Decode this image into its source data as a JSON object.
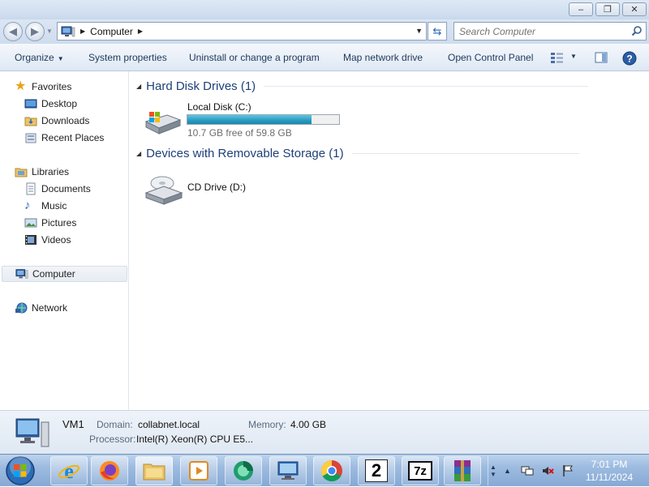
{
  "window": {
    "minimize": "‒",
    "maximize": "❐",
    "close": "✕"
  },
  "address": {
    "crumb": "Computer",
    "search_placeholder": "Search Computer"
  },
  "toolbar": {
    "organize": "Organize",
    "system_properties": "System properties",
    "uninstall": "Uninstall or change a program",
    "map_drive": "Map network drive",
    "control_panel": "Open Control Panel"
  },
  "nav": {
    "favorites": "Favorites",
    "desktop": "Desktop",
    "downloads": "Downloads",
    "recent": "Recent Places",
    "libraries": "Libraries",
    "documents": "Documents",
    "music": "Music",
    "pictures": "Pictures",
    "videos": "Videos",
    "computer": "Computer",
    "network": "Network"
  },
  "groups": {
    "hdd": "Hard Disk Drives (1)",
    "removable": "Devices with Removable Storage (1)"
  },
  "drives": {
    "c_label": "Local Disk (C:)",
    "c_free": "10.7 GB free of 59.8 GB",
    "c_used_fraction": 0.82,
    "d_label": "CD Drive (D:)"
  },
  "details": {
    "name": "VM1",
    "domain_key": "Domain:",
    "domain_val": "collabnet.local",
    "memory_key": "Memory:",
    "memory_val": "4.00 GB",
    "processor_key": "Processor:",
    "processor_val": "Intel(R) Xeon(R) CPU E5..."
  },
  "taskbar": {
    "app_2_label": "2",
    "app_7z_label": "7z",
    "time": "7:01 PM",
    "date": "11/11/2024"
  },
  "colors": {
    "accent": "#1e3f7a",
    "bar_fill": "#2a9ac0"
  }
}
